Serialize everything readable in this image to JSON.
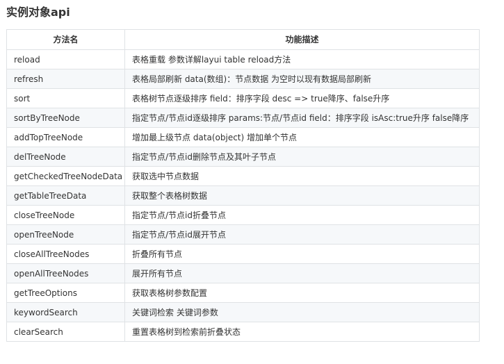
{
  "title": "实例对象api",
  "table": {
    "headers": [
      "方法名",
      "功能描述"
    ],
    "rows": [
      {
        "name": "reload",
        "desc": "表格重载 参数详解layui table reload方法"
      },
      {
        "name": "refresh",
        "desc": "表格局部刷新 data(数组)：节点数据 为空时以现有数据局部刷新"
      },
      {
        "name": "sort",
        "desc": "表格树节点逐级排序 field：排序字段 desc => true降序、false升序"
      },
      {
        "name": "sortByTreeNode",
        "desc": "指定节点/节点id逐级排序 params:节点/节点id field：排序字段 isAsc:true升序 false降序"
      },
      {
        "name": "addTopTreeNode",
        "desc": "增加最上级节点 data(object) 增加单个节点"
      },
      {
        "name": "delTreeNode",
        "desc": "指定节点/节点id删除节点及其叶子节点"
      },
      {
        "name": "getCheckedTreeNodeData",
        "desc": "获取选中节点数据"
      },
      {
        "name": "getTableTreeData",
        "desc": "获取整个表格树数据"
      },
      {
        "name": "closeTreeNode",
        "desc": "指定节点/节点id折叠节点"
      },
      {
        "name": "openTreeNode",
        "desc": "指定节点/节点id展开节点"
      },
      {
        "name": "closeAllTreeNodes",
        "desc": "折叠所有节点"
      },
      {
        "name": "openAllTreeNodes",
        "desc": "展开所有节点"
      },
      {
        "name": "getTreeOptions",
        "desc": "获取表格树参数配置"
      },
      {
        "name": "keywordSearch",
        "desc": "关键词检索 关键词参数"
      },
      {
        "name": "clearSearch",
        "desc": "重置表格树到检索前折叠状态"
      }
    ]
  }
}
